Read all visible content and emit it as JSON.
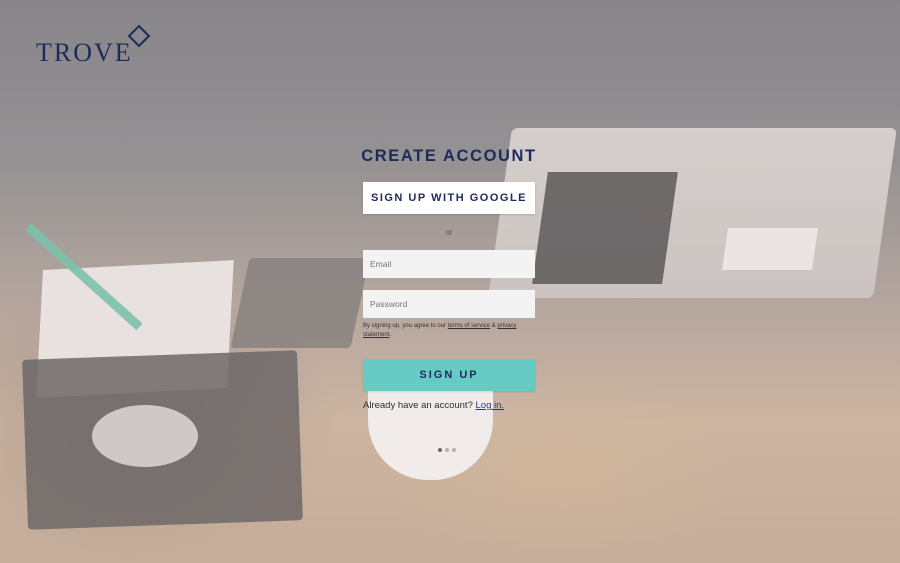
{
  "brand": {
    "logo_text": "TROVE",
    "color": "#1d2a5c"
  },
  "form": {
    "title": "CREATE ACCOUNT",
    "google_button": "SIGN UP WITH GOOGLE",
    "divider": "or",
    "email_placeholder": "Email",
    "password_placeholder": "Password",
    "terms_prefix": "By signing up, you agree to our ",
    "terms_link": "terms of service",
    "terms_and": " & ",
    "privacy_link": "privacy statement",
    "terms_suffix": ".",
    "signup_button": "SIGN UP",
    "login_prompt": "Already have an account? ",
    "login_link": "Log in."
  },
  "carousel": {
    "count": 3,
    "active": 1
  },
  "colors": {
    "accent": "#66ccc3",
    "text_dark": "#1d2a5c"
  }
}
